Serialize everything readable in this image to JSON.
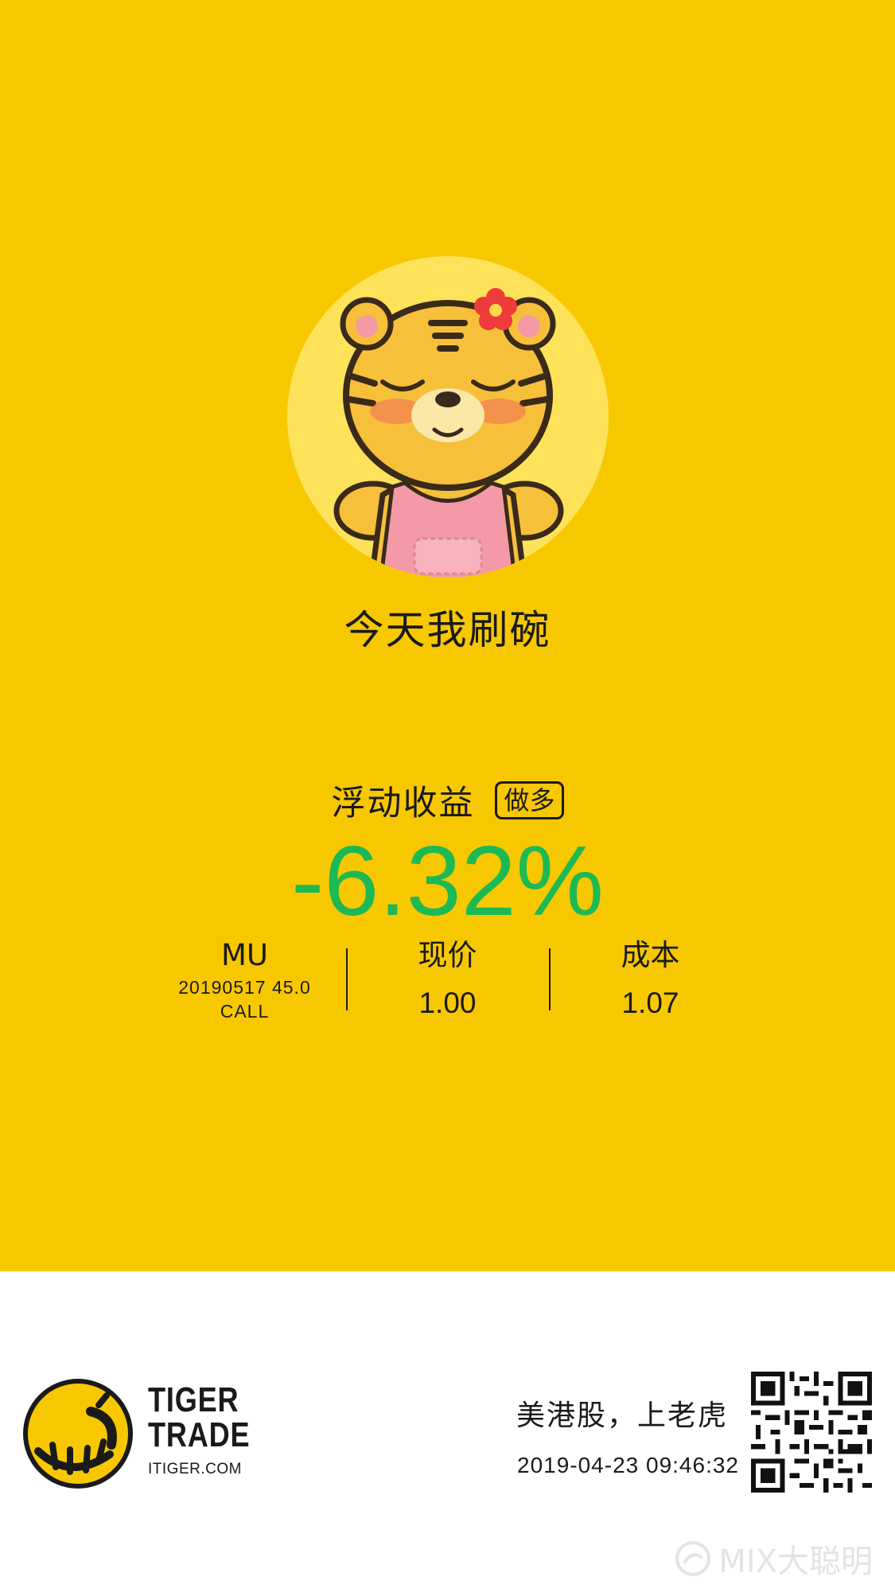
{
  "colors": {
    "background_top": "#F7C800",
    "background_bottom": "#FFFFFF",
    "pnl": "#1DB954",
    "text": "#1A1A1A"
  },
  "profile": {
    "avatar_icon": "tiger-mascot-icon",
    "nickname": "今天我刷碗"
  },
  "pnl": {
    "label": "浮动收益",
    "direction_tag": "做多",
    "value": "-6.32%"
  },
  "stats": {
    "symbol": "MU",
    "contract_line": "20190517  45.0",
    "contract_type": "CALL",
    "current_price_label": "现价",
    "current_price": "1.00",
    "cost_label": "成本",
    "cost": "1.07"
  },
  "footer": {
    "brand_line1": "TIGER",
    "brand_line2": "TRADE",
    "brand_url": "ITIGER.COM",
    "slogan": "美港股，上老虎",
    "timestamp": "2019-04-23 09:46:32",
    "qr_icon": "qr-code-icon",
    "watermark": "MIX大聪明"
  }
}
